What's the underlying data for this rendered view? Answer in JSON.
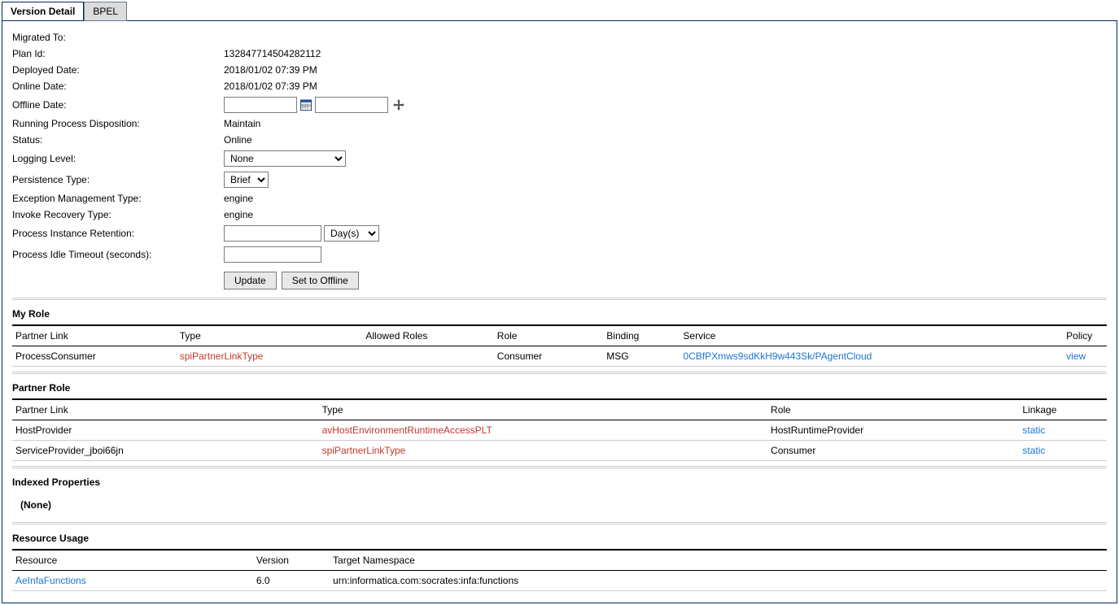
{
  "tabs": {
    "version_detail": "Version Detail",
    "bpel": "BPEL"
  },
  "fields": {
    "migrated_to": {
      "label": "Migrated To:",
      "value": ""
    },
    "plan_id": {
      "label": "Plan Id:",
      "value": "132847714504282112"
    },
    "deployed_date": {
      "label": "Deployed Date:",
      "value": "2018/01/02 07:39 PM"
    },
    "online_date": {
      "label": "Online Date:",
      "value": "2018/01/02 07:39 PM"
    },
    "offline_date": {
      "label": "Offline Date:",
      "date_value": "",
      "time_value": ""
    },
    "disposition": {
      "label": "Running Process Disposition:",
      "value": "Maintain"
    },
    "status": {
      "label": "Status:",
      "value": "Online"
    },
    "logging": {
      "label": "Logging Level:",
      "value": "None"
    },
    "persistence": {
      "label": "Persistence Type:",
      "value": "Brief"
    },
    "exception": {
      "label": "Exception Management Type:",
      "value": "engine"
    },
    "invoke": {
      "label": "Invoke Recovery Type:",
      "value": "engine"
    },
    "retention": {
      "label": "Process Instance Retention:",
      "value": "",
      "unit": "Day(s)"
    },
    "idle_timeout": {
      "label": "Process Idle Timeout (seconds):",
      "value": ""
    }
  },
  "buttons": {
    "update": "Update",
    "offline": "Set to Offline"
  },
  "my_role": {
    "title": "My Role",
    "headers": {
      "partner_link": "Partner Link",
      "type": "Type",
      "allowed_roles": "Allowed Roles",
      "role": "Role",
      "binding": "Binding",
      "service": "Service",
      "policy": "Policy"
    },
    "rows": [
      {
        "partner_link": "ProcessConsumer",
        "type": "spiPartnerLinkType",
        "allowed_roles": "",
        "role": "Consumer",
        "binding": "MSG",
        "service": "0CBfPXmws9sdKkH9w443Sk/PAgentCloud",
        "policy": "view"
      }
    ]
  },
  "partner_role": {
    "title": "Partner Role",
    "headers": {
      "partner_link": "Partner Link",
      "type": "Type",
      "role": "Role",
      "linkage": "Linkage"
    },
    "rows": [
      {
        "partner_link": "HostProvider",
        "type": "avHostEnvironmentRuntimeAccessPLT",
        "role": "HostRuntimeProvider",
        "linkage": "static"
      },
      {
        "partner_link": "ServiceProvider_jboi66jn",
        "type": "spiPartnerLinkType",
        "role": "Consumer",
        "linkage": "static"
      }
    ]
  },
  "indexed_properties": {
    "title": "Indexed Properties",
    "none": "(None)"
  },
  "resource_usage": {
    "title": "Resource Usage",
    "headers": {
      "resource": "Resource",
      "version": "Version",
      "target_ns": "Target Namespace"
    },
    "rows": [
      {
        "resource": "AeInfaFunctions",
        "version": "6.0",
        "target_ns": "urn:informatica.com:socrates:infa:functions"
      }
    ]
  }
}
